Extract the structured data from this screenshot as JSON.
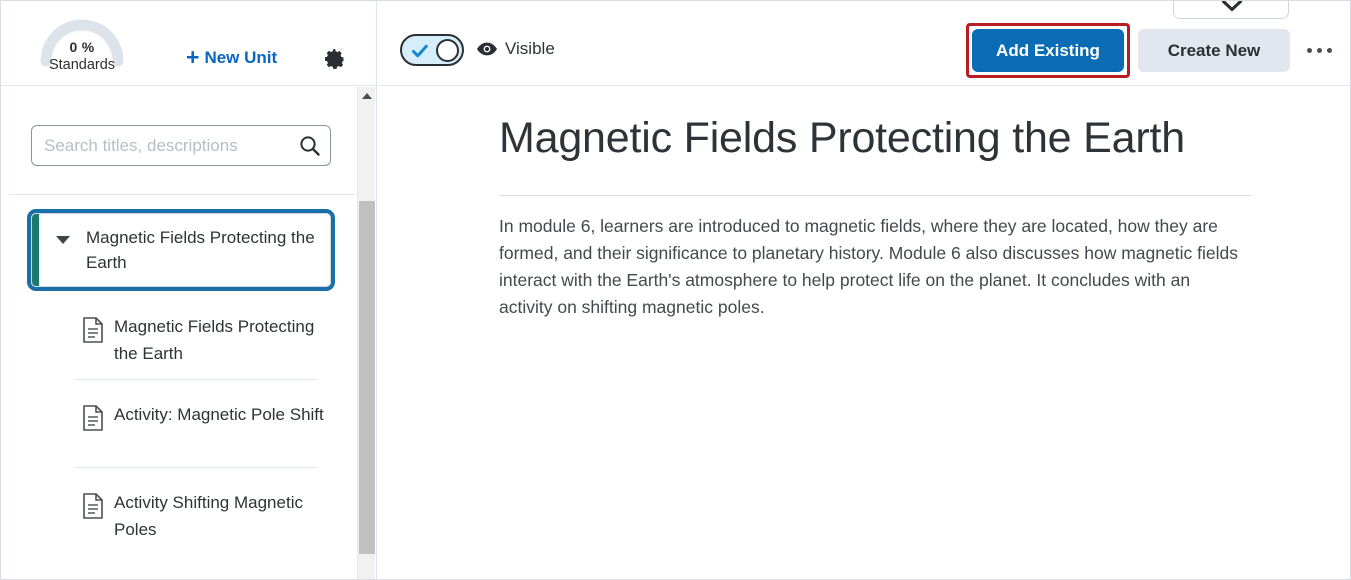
{
  "left_panel": {
    "gauge": {
      "percent": "0 %",
      "label": "Standards",
      "value": 0,
      "track_color": "#dde3ea"
    },
    "new_unit_button": "New Unit",
    "new_unit_plus": "+",
    "settings_icon": "gear-icon",
    "search": {
      "placeholder": "Search titles, descriptions",
      "value": "",
      "icon": "search-icon"
    },
    "unit": {
      "title": "Magnetic Fields Protecting the Earth",
      "expanded": true,
      "caret_icon": "caret-down-icon",
      "accent_color": "#1b7a6e",
      "focus_ring_color": "#1a6fa8"
    },
    "tree_items": [
      {
        "label": "Magnetic Fields Protecting the Earth",
        "icon": "document-icon"
      },
      {
        "label": "Activity: Magnetic Pole Shift",
        "icon": "document-icon"
      },
      {
        "label": "Activity Shifting Magnetic Poles",
        "icon": "document-icon"
      }
    ],
    "scrollbar": {
      "up_arrow_icon": "caret-up-icon"
    }
  },
  "main_header": {
    "toggle": {
      "state": "on",
      "check_icon": "check-icon"
    },
    "visibility_icon": "eye-icon",
    "visibility_label": "Visible",
    "partial_dropdown_icon": "chevron-down-icon",
    "add_existing_button": "Add Existing",
    "create_new_button": "Create New",
    "more_options_icon": "ellipsis-icon",
    "highlight_color": "#b81d26",
    "primary_color": "#0a6cb4"
  },
  "content": {
    "title": "Magnetic Fields Protecting the Earth",
    "body": "In module 6, learners are introduced to magnetic fields, where they are located, how they are formed, and their significance to planetary history. Module 6 also discusses how magnetic fields interact with the Earth's atmosphere to help protect life on the planet. It concludes with an activity on shifting magnetic poles."
  }
}
